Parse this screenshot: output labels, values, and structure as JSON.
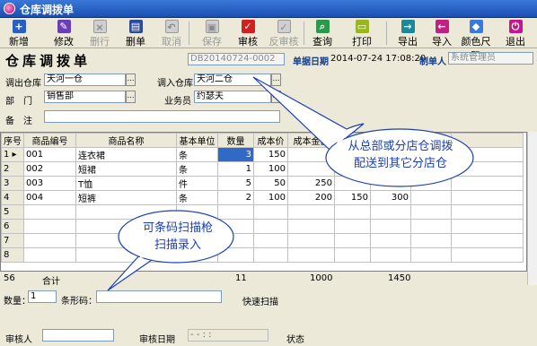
{
  "window": {
    "title": "仓库调拨单"
  },
  "toolbar": [
    {
      "label": "新增",
      "icon": "add-icon",
      "color": "#2a5fbf",
      "enabled": true
    },
    {
      "label": "修改",
      "icon": "edit-icon",
      "color": "#6a3fb5",
      "enabled": true
    },
    {
      "label": "删行",
      "icon": "delete-row-icon",
      "color": "#cfcfcf",
      "enabled": false
    },
    {
      "label": "删单",
      "icon": "delete-doc-icon",
      "color": "#2a4a9a",
      "enabled": true
    },
    {
      "label": "取消",
      "icon": "undo-icon",
      "color": "#cfcfcf",
      "enabled": false
    },
    {
      "label": "保存",
      "icon": "save-icon",
      "color": "#cfcfcf",
      "enabled": false
    },
    {
      "label": "审核",
      "icon": "check-icon",
      "color": "#d02020",
      "enabled": true
    },
    {
      "label": "反审核",
      "icon": "uncheck-icon",
      "color": "#cfcfcf",
      "enabled": false
    },
    {
      "label": "查询",
      "icon": "search-icon",
      "color": "#2a9a4a",
      "enabled": true
    },
    {
      "label": "打印",
      "icon": "print-icon",
      "color": "#9ab520",
      "enabled": true
    },
    {
      "label": "导出",
      "icon": "export-icon",
      "color": "#1a8a9a",
      "enabled": true
    },
    {
      "label": "导入",
      "icon": "import-icon",
      "color": "#c02080",
      "enabled": true
    },
    {
      "label": "颜色尺码",
      "icon": "color-size-icon",
      "color": "#3a7adf",
      "enabled": true
    },
    {
      "label": "退出",
      "icon": "exit-icon",
      "color": "#c01a8a",
      "enabled": true
    }
  ],
  "header": {
    "title": "仓库调拨单",
    "doc_no": "DB20140724-0002",
    "date_label": "单据日期",
    "date_value": "2014-07-24 17:08:20",
    "creator_label": "制单人",
    "creator_value": "系统管理员"
  },
  "form": {
    "out_wh_label": "调出仓库",
    "out_wh_value": "天河一仓",
    "in_wh_label": "调入仓库",
    "in_wh_value": "天河二仓",
    "dept_label": "部　门",
    "dept_value": "销售部",
    "staff_label": "业务员",
    "staff_value": "约瑟夫",
    "note_label": "备　注",
    "note_value": ""
  },
  "grid": {
    "columns": [
      "序号",
      "商品编号",
      "商品名称",
      "基本单位",
      "数量",
      "成本价",
      "成本金额",
      "",
      "",
      ""
    ],
    "rows": [
      [
        "1",
        "001",
        "连衣裙",
        "条",
        "3",
        "150",
        "",
        "",
        "",
        ""
      ],
      [
        "2",
        "002",
        "短裙",
        "条",
        "1",
        "100",
        "",
        "",
        "",
        ""
      ],
      [
        "3",
        "003",
        "T恤",
        "件",
        "5",
        "50",
        "250",
        "",
        "",
        ""
      ],
      [
        "4",
        "004",
        "短裤",
        "条",
        "2",
        "100",
        "200",
        "150",
        "300",
        ""
      ]
    ],
    "totals": {
      "row": "56",
      "label": "合计",
      "qty": "11",
      "amount": "1000",
      "extra": "1450"
    }
  },
  "bottom": {
    "qty_label": "数量：",
    "qty_value": "1",
    "barcode_label": "条形码：",
    "barcode_value": "",
    "quick_scan": "快速扫描",
    "auditor_label": "审核人",
    "auditor_value": "",
    "audit_date_label": "审核日期",
    "audit_date_value": "-   -   :  :",
    "status_label": "状态"
  },
  "callouts": {
    "transfer": "从总部或分店仓调拨\n配送到其它分店仓",
    "scan": "可条码扫描枪\n扫描录入"
  }
}
